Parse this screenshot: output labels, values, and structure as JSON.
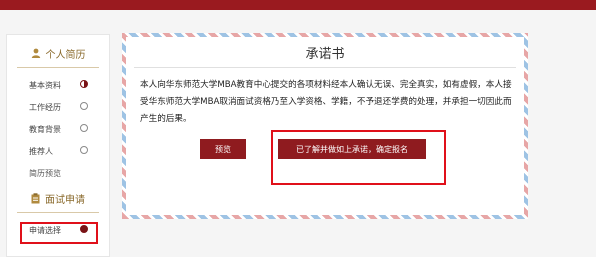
{
  "sidebar": {
    "section1": {
      "title": "个人简历",
      "icon": "user-icon"
    },
    "items": [
      {
        "label": "基本资料",
        "state": "half"
      },
      {
        "label": "工作经历",
        "state": "empty"
      },
      {
        "label": "教育背景",
        "state": "empty"
      },
      {
        "label": "推荐人",
        "state": "empty"
      }
    ],
    "preview_label": "简历预览",
    "section2": {
      "title": "面试申请",
      "icon": "clipboard-icon"
    },
    "apply_item": {
      "label": "申请选择",
      "state": "full"
    }
  },
  "commitment": {
    "title": "承诺书",
    "body": "本人向华东师范大学MBA教育中心提交的各项材料经本人确认无误、完全真实，如有虚假，本人接受华东师范大学MBA取消面试资格乃至入学资格、学籍，不予退还学费的处理，并承担一切因此而产生的后果。",
    "preview_button": "预览",
    "confirm_button": "已了解并做如上承诺，确定报名"
  },
  "colors": {
    "brand": "#9a1a1f",
    "button": "#8f1b1f",
    "highlight": "#e0101a",
    "section_text": "#8a6a2c"
  }
}
